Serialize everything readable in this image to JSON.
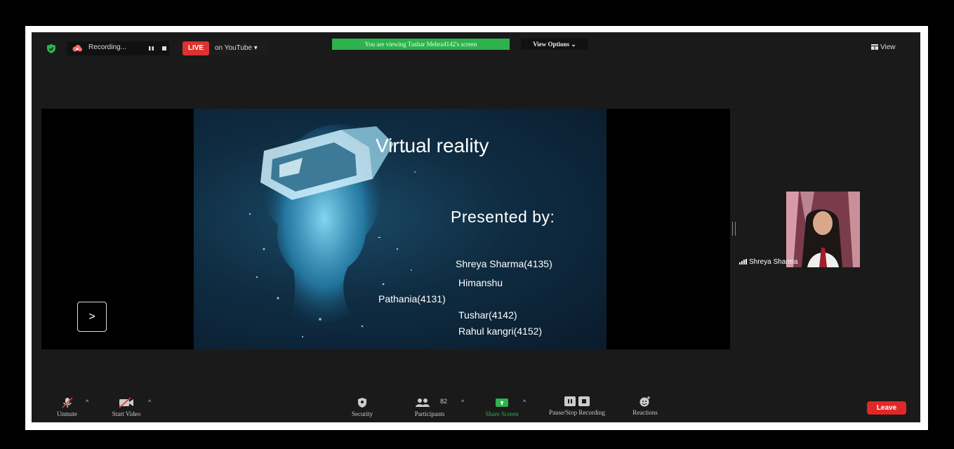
{
  "topbar": {
    "recording_label": "Recording...",
    "live_badge": "LIVE",
    "live_destination": "on YouTube ▾",
    "viewing_banner": "You are viewing Tushar Mehra4142's screen",
    "view_options": "View Options ⌄",
    "view_button": "View"
  },
  "slide": {
    "title": "Virtual reality",
    "subtitle": "Presented  by:",
    "dash": "-",
    "lines": [
      "Shreya Sharma(4135)",
      "Himanshu",
      "Pathania(4131)",
      "Tushar(4142)",
      "Rahul kangri(4152)"
    ],
    "next_arrow": ">"
  },
  "participant": {
    "name": "Shreya Sharma"
  },
  "toolbar": {
    "unmute": "Unmute",
    "start_video": "Start Video",
    "security": "Security",
    "participants": "Participants",
    "participants_count": "82",
    "share_screen": "Share Screen",
    "pause_stop_recording": "Pause/Stop Recording",
    "reactions": "Reactions",
    "leave": "Leave",
    "caret": "^"
  },
  "colors": {
    "live_red": "#e03131",
    "share_green": "#2db24e",
    "leave_red": "#e02828",
    "app_bg": "#1a1a1a"
  }
}
